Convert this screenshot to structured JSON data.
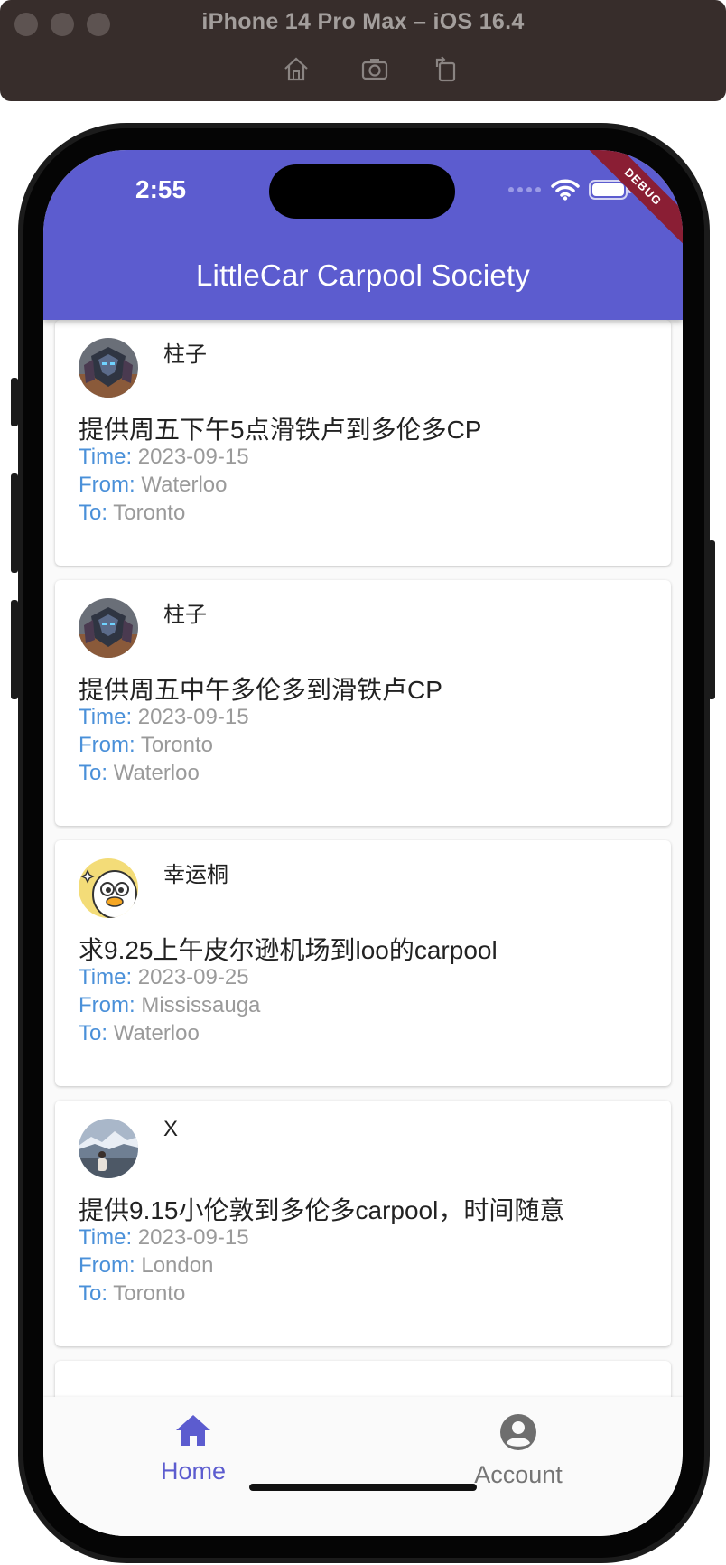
{
  "simulator": {
    "title": "iPhone 14 Pro Max – iOS 16.4"
  },
  "status_bar": {
    "time": "2:55"
  },
  "app_bar": {
    "title": "LittleCar Carpool Society",
    "debug_label": "DEBUG"
  },
  "colors": {
    "primary": "#5c5ccf",
    "field_key": "#4a90d9",
    "field_value": "#9a9a9a",
    "ribbon": "#8a1e34"
  },
  "posts": [
    {
      "author": "柱子",
      "avatar": "transformer-avatar",
      "title": "提供周五下午5点滑铁卢到多伦多CP",
      "time_label": "Time:",
      "time": "2023-09-15",
      "from_label": "From:",
      "from": "Waterloo",
      "to_label": "To:",
      "to": "Toronto"
    },
    {
      "author": "柱子",
      "avatar": "transformer-avatar",
      "title": "提供周五中午多伦多到滑铁卢CP",
      "time_label": "Time:",
      "time": "2023-09-15",
      "from_label": "From:",
      "from": "Toronto",
      "to_label": "To:",
      "to": "Waterloo"
    },
    {
      "author": "幸运桐",
      "avatar": "duck-avatar",
      "title": "求9.25上午皮尔逊机场到loo的carpool",
      "time_label": "Time:",
      "time": "2023-09-25",
      "from_label": "From:",
      "from": "Mississauga",
      "to_label": "To:",
      "to": "Waterloo"
    },
    {
      "author": "X",
      "avatar": "landscape-avatar",
      "title": "提供9.15小伦敦到多伦多carpool，时间随意",
      "time_label": "Time:",
      "time": "2023-09-15",
      "from_label": "From:",
      "from": "London",
      "to_label": "To:",
      "to": "Toronto"
    }
  ],
  "bottom_nav": {
    "home_label": "Home",
    "account_label": "Account",
    "selected": "Home"
  }
}
